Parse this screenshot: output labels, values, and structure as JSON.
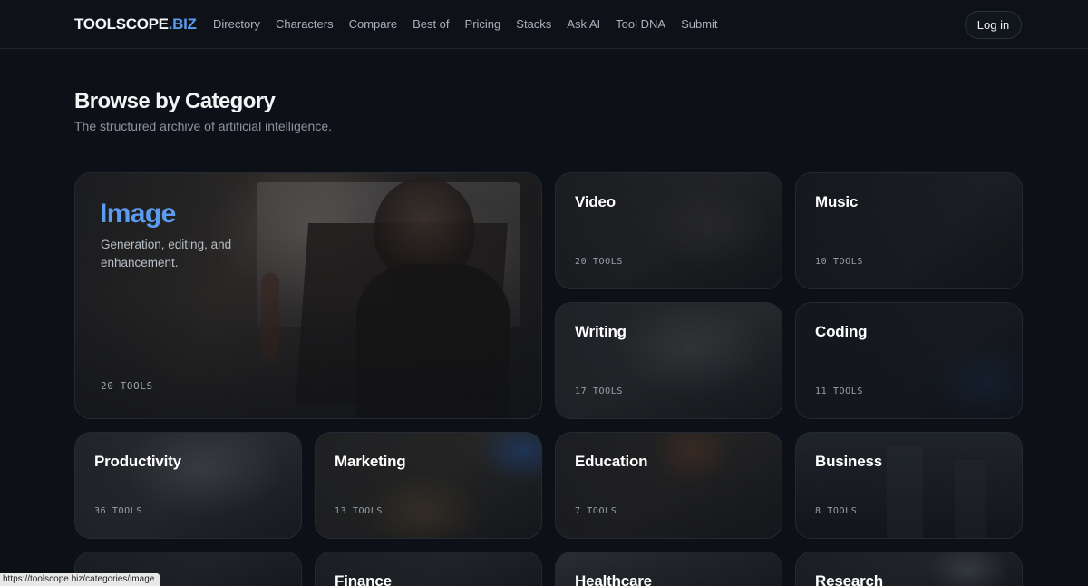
{
  "brand": {
    "name": "TOOLSCOPE",
    "tld": ".BIZ"
  },
  "nav": [
    "Directory",
    "Characters",
    "Compare",
    "Best of",
    "Pricing",
    "Stacks",
    "Ask AI",
    "Tool DNA",
    "Submit"
  ],
  "login_label": "Log in",
  "page": {
    "title": "Browse by Category",
    "subtitle": "The structured archive of artificial intelligence."
  },
  "featured": {
    "name": "Image",
    "description": "Generation, editing, and enhancement.",
    "count": "20 TOOLS"
  },
  "categories": [
    {
      "name": "Video",
      "count": "20 TOOLS"
    },
    {
      "name": "Music",
      "count": "10 TOOLS"
    },
    {
      "name": "Writing",
      "count": "17 TOOLS"
    },
    {
      "name": "Coding",
      "count": "11 TOOLS"
    },
    {
      "name": "Productivity",
      "count": "36 TOOLS"
    },
    {
      "name": "Marketing",
      "count": "13 TOOLS"
    },
    {
      "name": "Education",
      "count": "7 TOOLS"
    },
    {
      "name": "Business",
      "count": "8 TOOLS"
    },
    {
      "name": "",
      "count": ""
    },
    {
      "name": "Finance",
      "count": ""
    },
    {
      "name": "Healthcare",
      "count": ""
    },
    {
      "name": "Research",
      "count": ""
    }
  ],
  "status_url": "https://toolscope.biz/categories/image",
  "colors": {
    "background": "#0d1117",
    "accent": "#5b9bf0",
    "card": "#161b22"
  }
}
